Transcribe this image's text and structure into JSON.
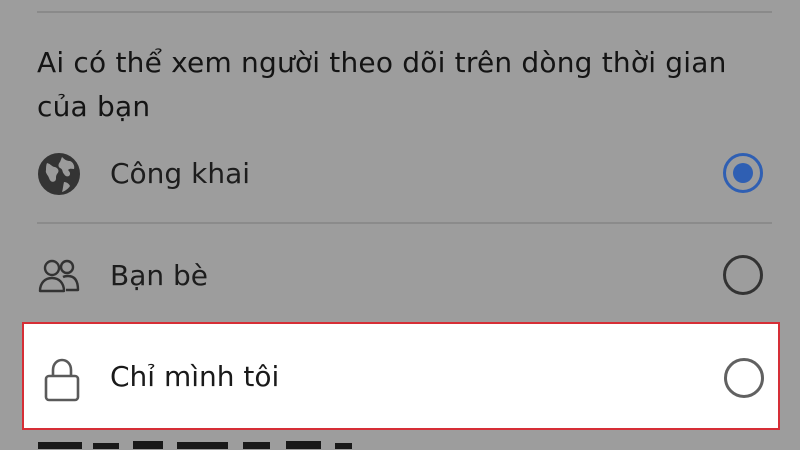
{
  "section": {
    "title": "Ai có thể xem người theo dõi trên dòng thời gian của bạn"
  },
  "options": [
    {
      "label": "Công khai",
      "icon": "globe-icon",
      "selected": true
    },
    {
      "label": "Bạn bè",
      "icon": "friends-icon",
      "selected": false
    },
    {
      "label": "Chỉ mình tôi",
      "icon": "lock-icon",
      "selected": false,
      "highlighted": true
    }
  ],
  "colors": {
    "overlay": "#9d9d9d",
    "selected_radio": "#2f5fb3",
    "highlight_border": "#d62e36",
    "text": "#141414"
  }
}
